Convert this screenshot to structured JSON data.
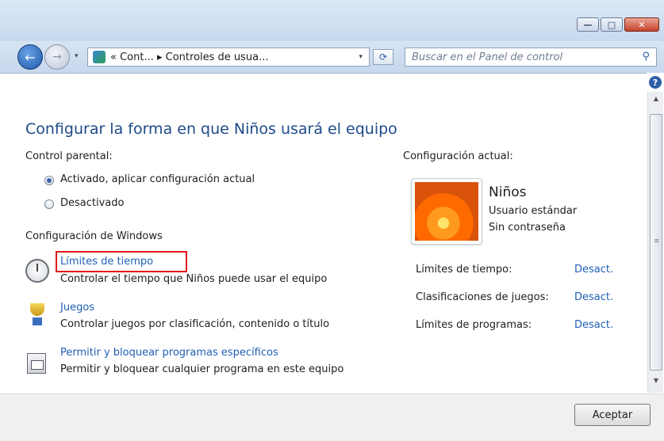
{
  "window": {
    "minimize_glyph": "—",
    "maximize_glyph": "□",
    "close_glyph": "✕"
  },
  "nav": {
    "back_glyph": "←",
    "forward_glyph": "→",
    "dropdown_glyph": "▾",
    "breadcrumb": "« Cont... ▸ Controles de usua...",
    "refresh_glyph": "⟳",
    "search_placeholder": "Buscar en el Panel de control",
    "search_glyph": "⚲",
    "help_glyph": "?"
  },
  "scroll": {
    "up_glyph": "▲",
    "down_glyph": "▼",
    "grip_glyph": "≡"
  },
  "main": {
    "title": "Configurar la forma en que Niños usará el equipo",
    "parental_label": "Control parental:",
    "radio_on": "Activado, aplicar configuración actual",
    "radio_off": "Desactivado",
    "windows_settings_label": "Configuración de Windows",
    "items": [
      {
        "link": "Límites de tiempo",
        "desc": "Controlar el tiempo que Niños puede usar el equipo"
      },
      {
        "link": "Juegos",
        "desc": "Controlar juegos por clasificación, contenido o título"
      },
      {
        "link": "Permitir y bloquear programas específicos",
        "desc": "Permitir y bloquear cualquier programa en este equipo"
      }
    ]
  },
  "current": {
    "label": "Configuración actual:",
    "user_name": "Niños",
    "user_type": "Usuario estándar",
    "user_password": "Sin contraseña",
    "rows": [
      {
        "label": "Límites de tiempo:",
        "value": "Desact."
      },
      {
        "label": "Clasificaciones de juegos:",
        "value": "Desact."
      },
      {
        "label": "Límites de programas:",
        "value": "Desact."
      }
    ]
  },
  "footer": {
    "accept_label": "Aceptar"
  }
}
